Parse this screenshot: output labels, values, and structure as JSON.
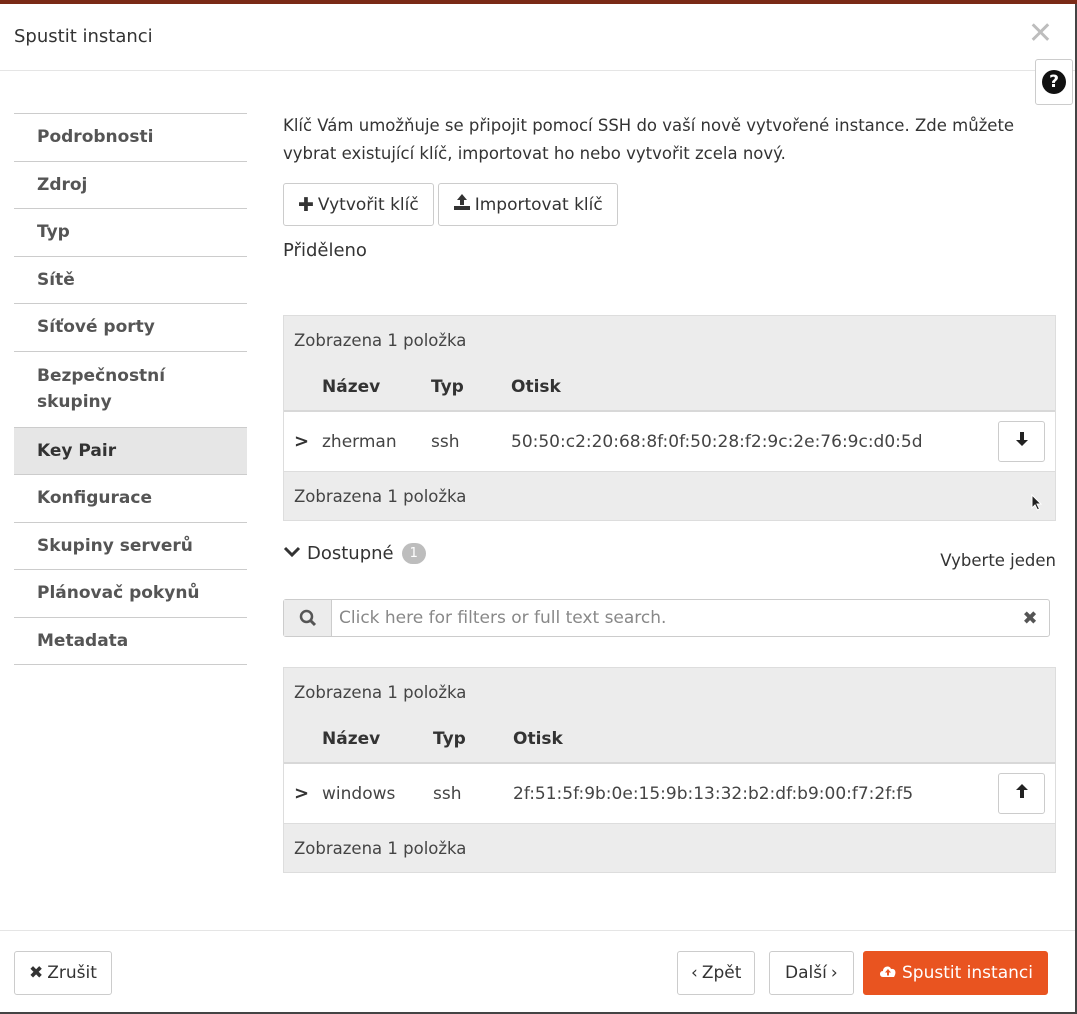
{
  "modal": {
    "title": "Spustit instanci",
    "close_icon": "close-icon",
    "help_icon": "help-icon"
  },
  "nav": {
    "items": [
      {
        "label": "Podrobnosti",
        "active": false
      },
      {
        "label": "Zdroj",
        "active": false
      },
      {
        "label": "Typ",
        "active": false
      },
      {
        "label": "Sítě",
        "active": false
      },
      {
        "label": "Síťové porty",
        "active": false
      },
      {
        "label": "Bezpečnostní skupiny",
        "active": false
      },
      {
        "label": "Key Pair",
        "active": true
      },
      {
        "label": "Konfigurace",
        "active": false
      },
      {
        "label": "Skupiny serverů",
        "active": false
      },
      {
        "label": "Plánovač pokynů",
        "active": false
      },
      {
        "label": "Metadata",
        "active": false
      }
    ]
  },
  "content": {
    "intro": "Klíč Vám umožňuje se připojit pomocí SSH do vaší nově vytvořené instance. Zde můžete vybrat existující klíč, importovat ho nebo vytvořit zcela nový.",
    "create_key_label": "Vytvořit klíč",
    "import_key_label": "Importovat klíč",
    "allocated_title": "Přiděleno",
    "allocated": {
      "info": "Zobrazena 1 položka",
      "columns": [
        "Název",
        "Typ",
        "Otisk"
      ],
      "rows": [
        {
          "name": "zherman",
          "type": "ssh",
          "fingerprint": "50:50:c2:20:68:8f:0f:50:28:f2:9c:2e:76:9c:d0:5d"
        }
      ]
    },
    "available_title": "Dostupné",
    "available_count": "1",
    "select_one": "Vyberte jeden",
    "search_placeholder": "Click here for filters or full text search.",
    "available": {
      "info": "Zobrazena 1 položka",
      "columns": [
        "Název",
        "Typ",
        "Otisk"
      ],
      "rows": [
        {
          "name": "windows",
          "type": "ssh",
          "fingerprint": "2f:51:5f:9b:0e:15:9b:13:32:b2:df:b9:00:f7:2f:f5"
        }
      ]
    }
  },
  "footer": {
    "cancel_label": "Zrušit",
    "back_label": "Zpět",
    "next_label": "Další",
    "launch_label": "Spustit instanci"
  },
  "colors": {
    "accent": "#e95420",
    "active_nav_bg": "#e6e6e6"
  }
}
